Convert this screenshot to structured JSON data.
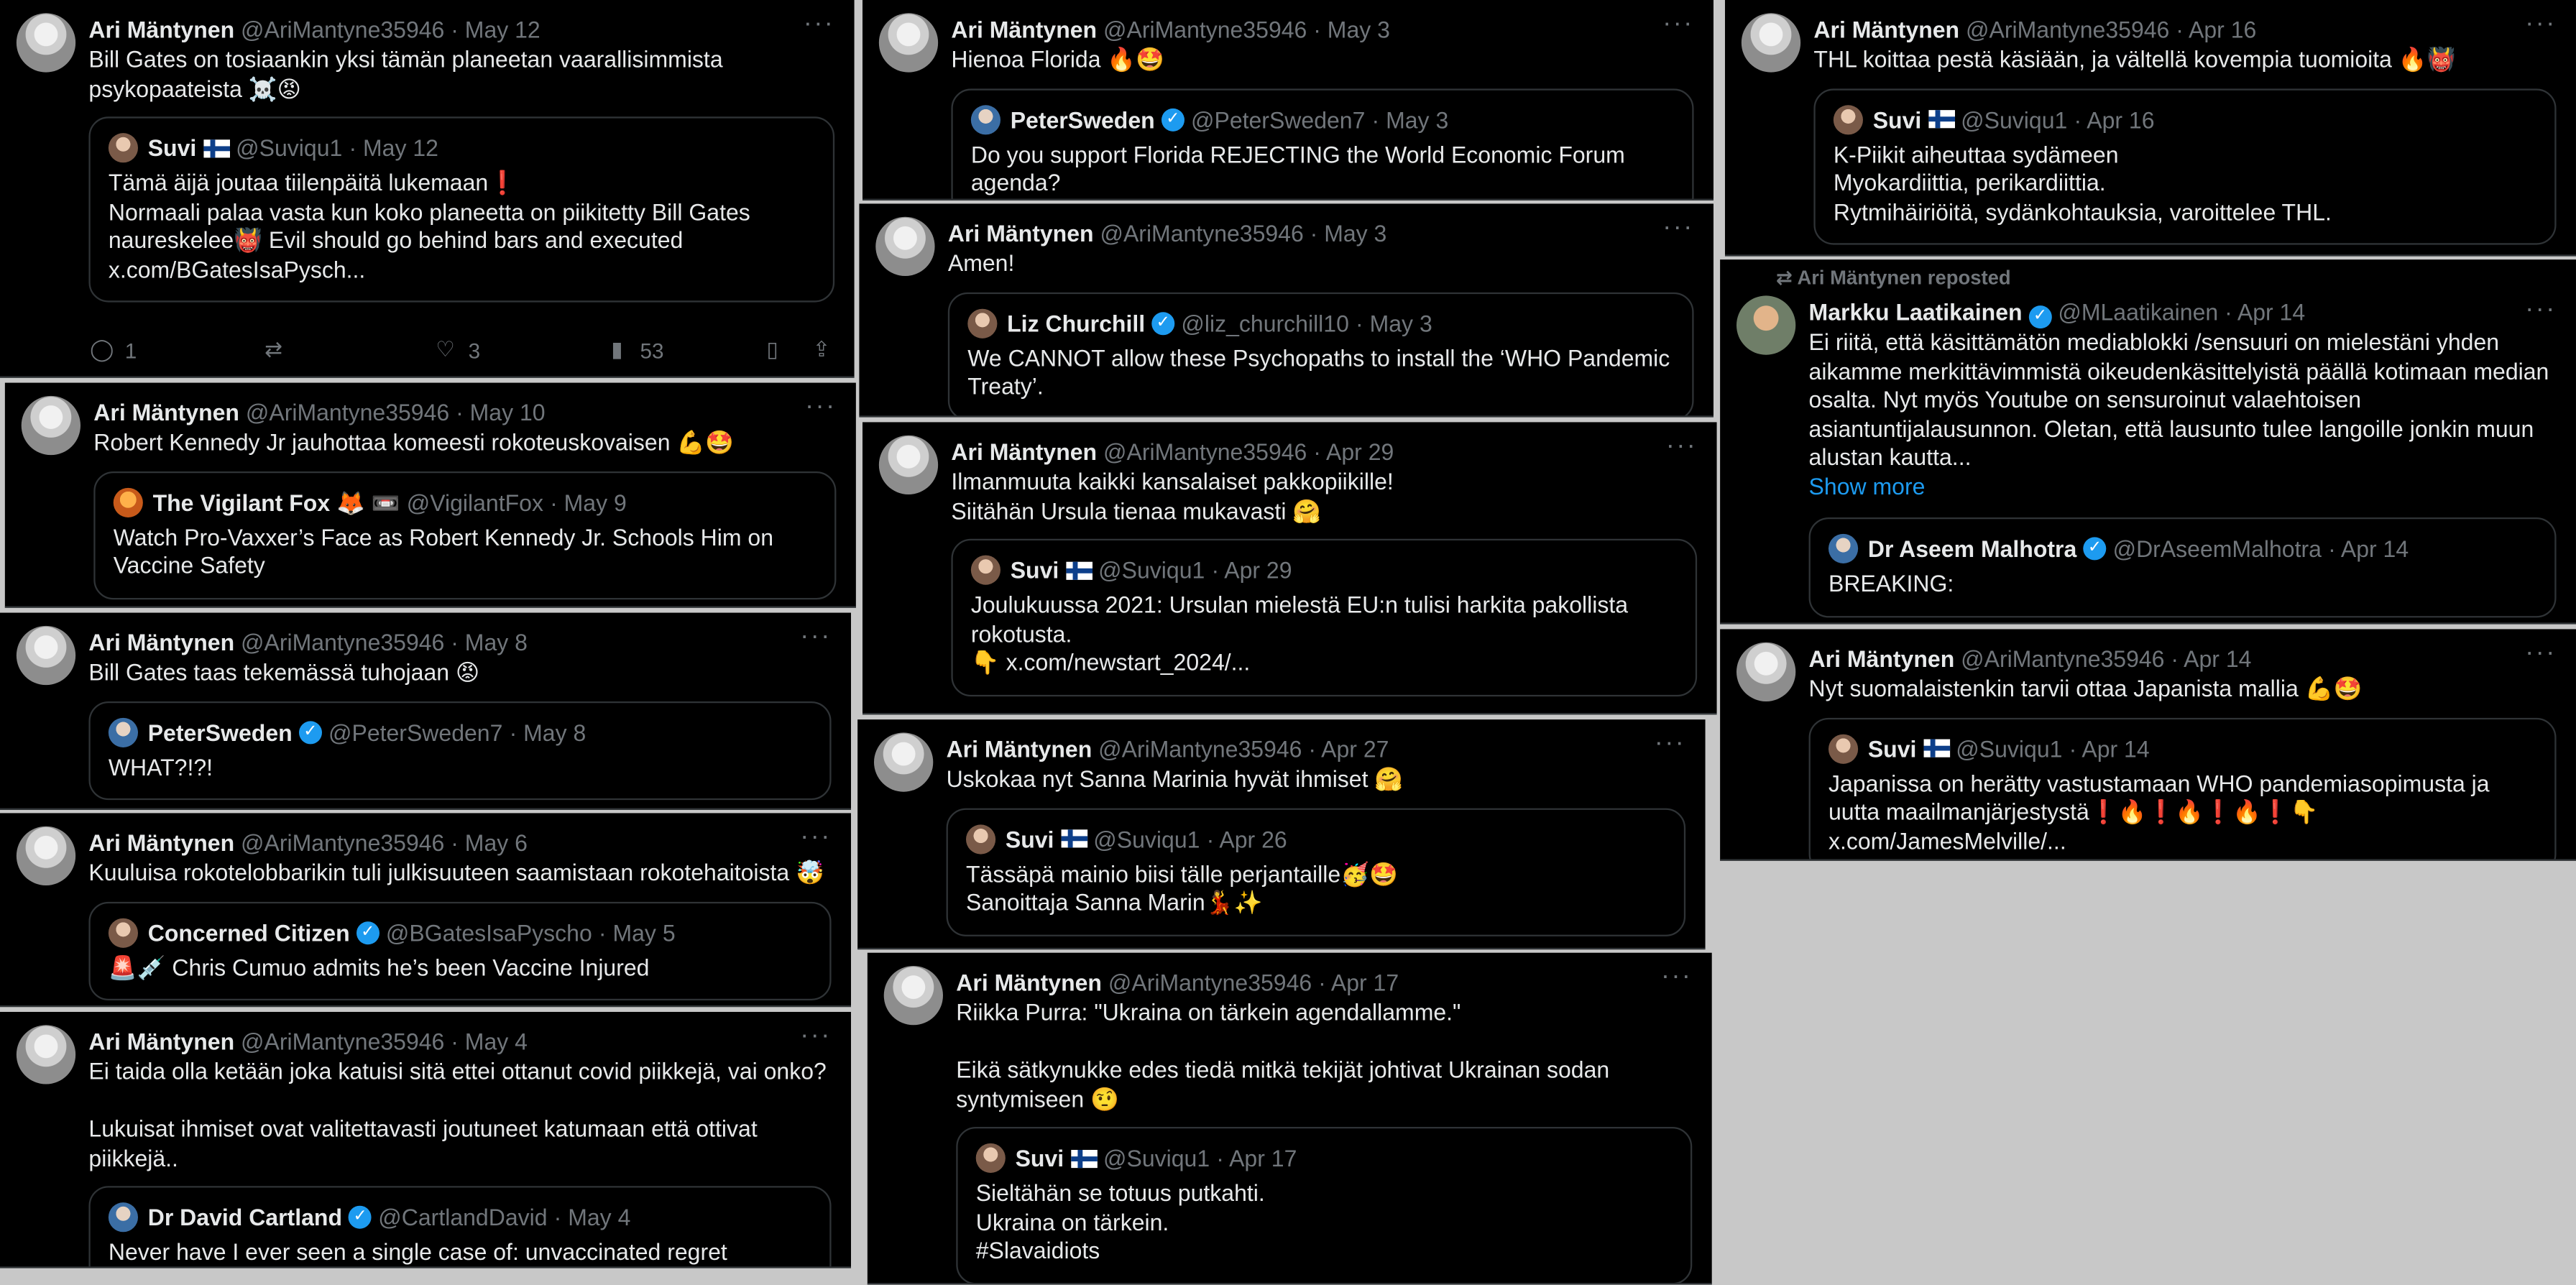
{
  "tweets": [
    {
      "name": "Ari Mäntynen",
      "handle": "@AriMantyne35946",
      "date": " · May 12",
      "text": "Bill Gates on tosiaankin yksi tämän planeetan vaarallisimmista psykopaateista ☠️😡",
      "quote": {
        "name": "Suvi",
        "handle": "@Suviqu1",
        "date": "· May 12",
        "text": "Tämä äijä joutaa tiilenpäitä lukemaan❗️\nNormaali palaa vasta kun koko planeetta on piikitetty Bill Gates naureskelee👹 Evil should go behind bars and executed\nx.com/BGatesIsaPysch..."
      },
      "actions": {
        "replies": "1",
        "retweets": "",
        "likes": "3",
        "views": "53"
      }
    },
    {
      "name": "Ari Mäntynen",
      "handle": "@AriMantyne35946",
      "date": " · May 10",
      "text": "Robert Kennedy Jr jauhottaa komeesti rokoteuskovaisen 💪🤩",
      "quote": {
        "name": "The Vigilant Fox 🦊 📼",
        "handle": "@VigilantFox",
        "date": "· May 9",
        "text": "Watch Pro-Vaxxer’s Face as Robert Kennedy Jr. Schools Him on Vaccine Safety"
      }
    },
    {
      "name": "Ari Mäntynen",
      "handle": "@AriMantyne35946",
      "date": " · May 8",
      "text": "Bill Gates taas tekemässä tuhojaan 😡",
      "quote": {
        "name": "PeterSweden",
        "handle": "@PeterSweden7",
        "date": "· May 8",
        "text": "WHAT?!?!"
      }
    },
    {
      "name": "Ari Mäntynen",
      "handle": "@AriMantyne35946",
      "date": " · May 6",
      "text": "Kuuluisa rokotelobbarikin tuli julkisuuteen saamistaan rokotehaitoista 🤯",
      "quote": {
        "name": "Concerned Citizen",
        "handle": "@BGatesIsaPyscho",
        "date": "· May 5",
        "text": "🚨💉 Chris Cumuo admits he’s been Vaccine Injured"
      }
    },
    {
      "name": "Ari Mäntynen",
      "handle": "@AriMantyne35946",
      "date": " · May 4",
      "text": "Ei taida olla ketään joka katuisi sitä ettei ottanut covid piikkejä, vai onko?\n\nLukuisat ihmiset ovat valitettavasti joutuneet katumaan että ottivat piikkejä..",
      "quote": {
        "name": "Dr David Cartland",
        "handle": "@CartlandDavid",
        "date": "· May 4",
        "text": "Never have I ever seen a single case of: unvaccinated regret"
      }
    },
    {
      "name": "Ari Mäntynen",
      "handle": "@AriMantyne35946",
      "date": " · May 3",
      "text": "Hienoa Florida 🔥🤩",
      "quote": {
        "name": "PeterSweden",
        "handle": "@PeterSweden7",
        "date": "· May 3",
        "text": "Do you support Florida REJECTING the World Economic Forum agenda?"
      }
    },
    {
      "name": "Ari Mäntynen",
      "handle": "@AriMantyne35946",
      "date": " · May 3",
      "text": "Amen!",
      "quote": {
        "name": "Liz Churchill",
        "handle": "@liz_churchill10",
        "date": "· May 3",
        "text": "We CANNOT allow these Psychopaths to install the ‘WHO Pandemic Treaty’."
      }
    },
    {
      "name": "Ari Mäntynen",
      "handle": "@AriMantyne35946",
      "date": " · Apr 29",
      "text": "Ilmanmuuta kaikki kansalaiset pakkopiikille!\nSiitähän Ursula tienaa mukavasti 🤗",
      "quote": {
        "name": "Suvi",
        "handle": "@Suviqu1",
        "date": "· Apr 29",
        "text": "Joulukuussa 2021: Ursulan mielestä EU:n tulisi harkita pakollista rokotusta.\n👇 x.com/newstart_2024/..."
      }
    },
    {
      "name": "Ari Mäntynen",
      "handle": "@AriMantyne35946",
      "date": " · Apr 27",
      "text": "Uskokaa nyt Sanna Marinia hyvät ihmiset 🤗",
      "quote": {
        "name": "Suvi",
        "handle": "@Suviqu1",
        "date": "· Apr 26",
        "text": "Tässäpä mainio biisi tälle perjantaille🥳🤩\nSanoittaja Sanna Marin💃✨"
      }
    },
    {
      "name": "Ari Mäntynen",
      "handle": "@AriMantyne35946",
      "date": " · Apr 17",
      "text": "Riikka Purra: \"Ukraina on tärkein agendallamme.\"\n\nEikä sätkynukke edes tiedä mitkä tekijät johtivat Ukrainan sodan syntymiseen 🤨",
      "quote": {
        "name": "Suvi",
        "handle": "@Suviqu1",
        "date": "· Apr 17",
        "text": "Sieltähän se totuus putkahti.\nUkraina on tärkein.\n#Slavaidiots"
      }
    },
    {
      "name": "Ari Mäntynen",
      "handle": "@AriMantyne35946",
      "date": " · Apr 16",
      "text": "THL koittaa pestä käsiään, ja vältellä kovempia tuomioita 🔥👹",
      "quote": {
        "name": "Suvi",
        "handle": "@Suviqu1",
        "date": "· Apr 16",
        "text": "K-Piikit aiheuttaa sydämeen\nMyokardiittia, perikardiittia.\nRytmihäiriöitä, sydänkohtauksia, varoittelee THL."
      }
    },
    {
      "reposted": "Ari Mäntynen reposted",
      "name": "Markku Laatikainen",
      "handle": "@MLaatikainen",
      "date": " · Apr 14",
      "text": "Ei riitä, että käsittämätön mediablokki /sensuuri on mielestäni yhden aikamme merkittävimmistä oikeudenkäsittelyistä päällä kotimaan median osalta. Nyt myös Youtube on sensuroinut valaehtoisen asiantuntijalausunnon. Oletan, että lausunto tulee langoille jonkin muun alustan kautta...",
      "show_more": "Show more",
      "quote": {
        "name": "Dr Aseem Malhotra",
        "handle": "@DrAseemMalhotra",
        "date": "· Apr 14",
        "text": "BREAKING:"
      }
    },
    {
      "name": "Ari Mäntynen",
      "handle": "@AriMantyne35946",
      "date": " · Apr 14",
      "text": "Nyt suomalaistenkin tarvii ottaa Japanista mallia 💪🤩",
      "quote": {
        "name": "Suvi",
        "handle": "@Suviqu1",
        "date": "· Apr 14",
        "text": "Japanissa on herätty vastustamaan WHO pandemiasopimusta ja uutta maailmanjärjestystä❗️🔥❗️🔥❗️🔥❗️👇 x.com/JamesMelville/..."
      }
    }
  ]
}
